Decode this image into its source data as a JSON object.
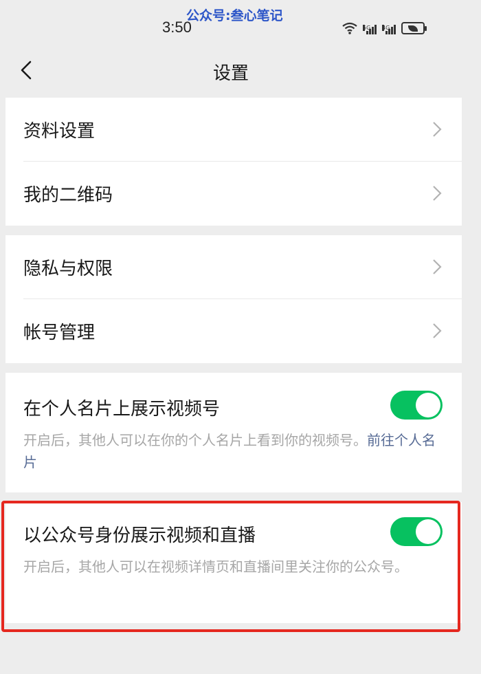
{
  "status_bar": {
    "time": "3:50",
    "watermark": "公众号:叁心笔记",
    "sig1_label": "5G",
    "sig2_label": "4G"
  },
  "nav": {
    "title": "设置"
  },
  "group1": {
    "items": [
      {
        "label": "资料设置"
      },
      {
        "label": "我的二维码"
      }
    ]
  },
  "group2": {
    "items": [
      {
        "label": "隐私与权限"
      },
      {
        "label": "帐号管理"
      }
    ]
  },
  "channel_card": {
    "title": "在个人名片上展示视频号",
    "desc": "开启后，其他人可以在你的个人名片上看到你的视频号。",
    "link": "前往个人名片",
    "enabled": true
  },
  "official_account": {
    "title": "以公众号身份展示视频和直播",
    "desc": "开启后，其他人可以在视频详情页和直播间里关注你的公众号。",
    "enabled": true
  },
  "colors": {
    "accent": "#07c160",
    "link": "#576b95",
    "highlight": "#e5281f"
  }
}
